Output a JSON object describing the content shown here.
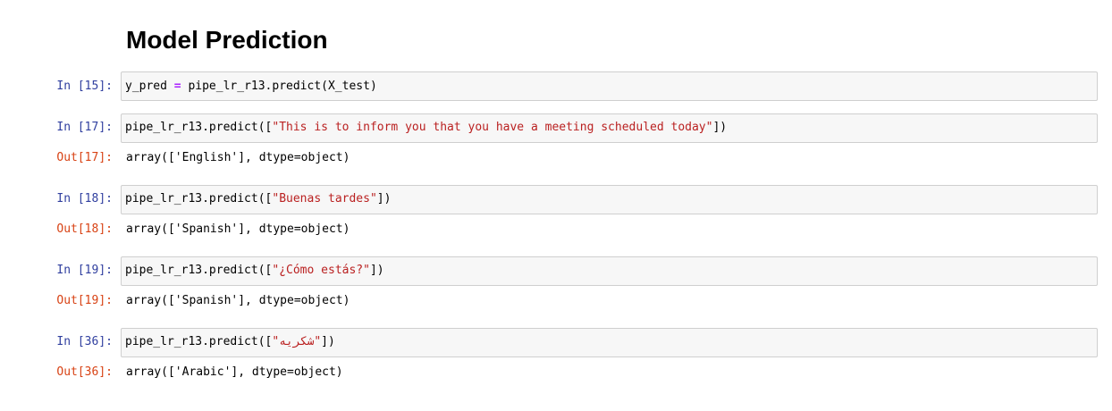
{
  "notebook": {
    "heading": "Model Prediction",
    "cells": [
      {
        "in_prompt": "In [15]:",
        "code_parts": [
          "y_pred ",
          "=",
          " pipe_lr_r13.predict(X_test)"
        ]
      },
      {
        "in_prompt": "In [17]:",
        "code_parts": [
          "pipe_lr_r13.predict([",
          "\"This is to inform you that you have a meeting scheduled today\"",
          "])"
        ],
        "out_prompt": "Out[17]:",
        "output": "array(['English'], dtype=object)"
      },
      {
        "in_prompt": "In [18]:",
        "code_parts": [
          "pipe_lr_r13.predict([",
          "\"Buenas tardes\"",
          "])"
        ],
        "out_prompt": "Out[18]:",
        "output": "array(['Spanish'], dtype=object)"
      },
      {
        "in_prompt": "In [19]:",
        "code_parts": [
          "pipe_lr_r13.predict([",
          "\"¿Cómo estás?\"",
          "])"
        ],
        "out_prompt": "Out[19]:",
        "output": "array(['Spanish'], dtype=object)"
      },
      {
        "in_prompt": "In [36]:",
        "code_parts": [
          "pipe_lr_r13.predict([",
          "\"شكريه\"",
          "])"
        ],
        "out_prompt": "Out[36]:",
        "output": "array(['Arabic'], dtype=object)"
      }
    ]
  },
  "colors": {
    "in_prompt": "#303f9f",
    "out_prompt": "#d84315",
    "string": "#ba2121",
    "operator": "#aa22ff",
    "input_background": "#f7f7f7",
    "input_border": "#cfcfcf"
  }
}
